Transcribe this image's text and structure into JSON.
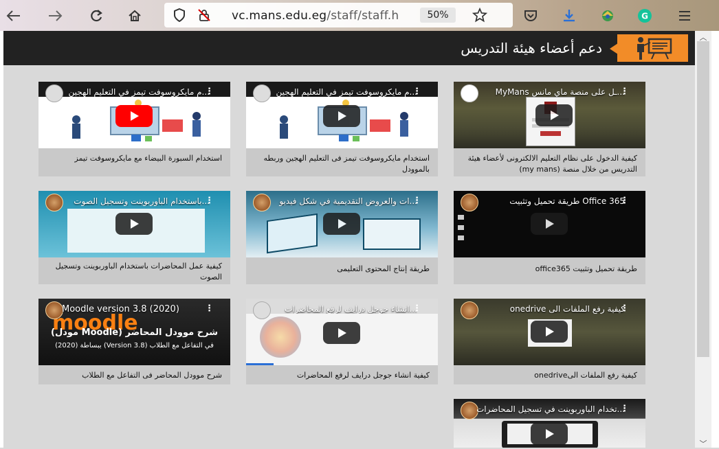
{
  "browser": {
    "url_host": "vc.mans.edu.eg",
    "url_path": "/staff/staff.h",
    "zoom": "50%"
  },
  "page": {
    "title": "دعم أعضاء هيئة التدريس"
  },
  "videos": [
    {
      "thumb_title": "...ـل على منصة ماي مانس MyMans",
      "caption": "كيفية الدخول على نظام التعليم الالكترونى لأعضاء هيئة التدريس من خلال منصة (my mans)"
    },
    {
      "thumb_title": "...م مايكروسوفت تيمز في التعليم الهجين",
      "caption": "استخدام مايكروسوفت تيمز فى التعليم الهجين وربطه بالموودل"
    },
    {
      "thumb_title": "...م مايكروسوفت تيمز في التعليم الهجين",
      "caption": "استخدام السبورة البيضاء مع مايكروسوفت تيمز"
    },
    {
      "thumb_title": "Office 365 طريقة تحميل وتثبيت",
      "caption": "طريقة تحميل وتثبيت office365"
    },
    {
      "thumb_title": "...ات والعروض التقديمية في شكل فيديو",
      "caption": "طريقة إنتاج المحتوى التعليمى"
    },
    {
      "thumb_title": "...باستخدام الباوربوينت وتسجيل الصوت",
      "caption": "كيفية عمل المحاضرات باستخدام الباوربوينت وتسجيل الصوت"
    },
    {
      "thumb_title": "كيفية رفع الملفات الى onedrive",
      "caption": "كيفية رفع الملفات الىonedrive"
    },
    {
      "thumb_title": "...انشاء جوجل درايف لرفع المحاضرات",
      "caption": "كيفية انشاء جوجل درايف لرفع المحاضرات"
    },
    {
      "thumb_title": "Moodle version 3.8 (2020)",
      "caption": "شرح موودل المحاضر فى التفاعل مع الطلاب",
      "overlay_line1": "شرح موودل المحاضر (Moodle مودل)",
      "overlay_line2": "في التفاعل مع الطلاب (Version 3.8) ببساطة (2020)",
      "overlay_logo": "moodle"
    },
    {
      "thumb_title": "...تخدام الباوربوينت في تسجيل المحاضرات",
      "caption": ""
    }
  ],
  "colors": {
    "accent": "#f28c28",
    "header_bg": "#222222",
    "page_bg": "#d9d9d9",
    "card_bg": "#c9c9c9"
  },
  "icons": [
    "back-arrow-icon",
    "forward-arrow-icon",
    "reload-icon",
    "home-icon",
    "shield-icon",
    "lock-strike-icon",
    "bookmark-star-icon",
    "pocket-icon",
    "download-icon",
    "extension-icon",
    "grammarly-icon",
    "menu-icon",
    "teacher-board-icon",
    "play-icon"
  ]
}
